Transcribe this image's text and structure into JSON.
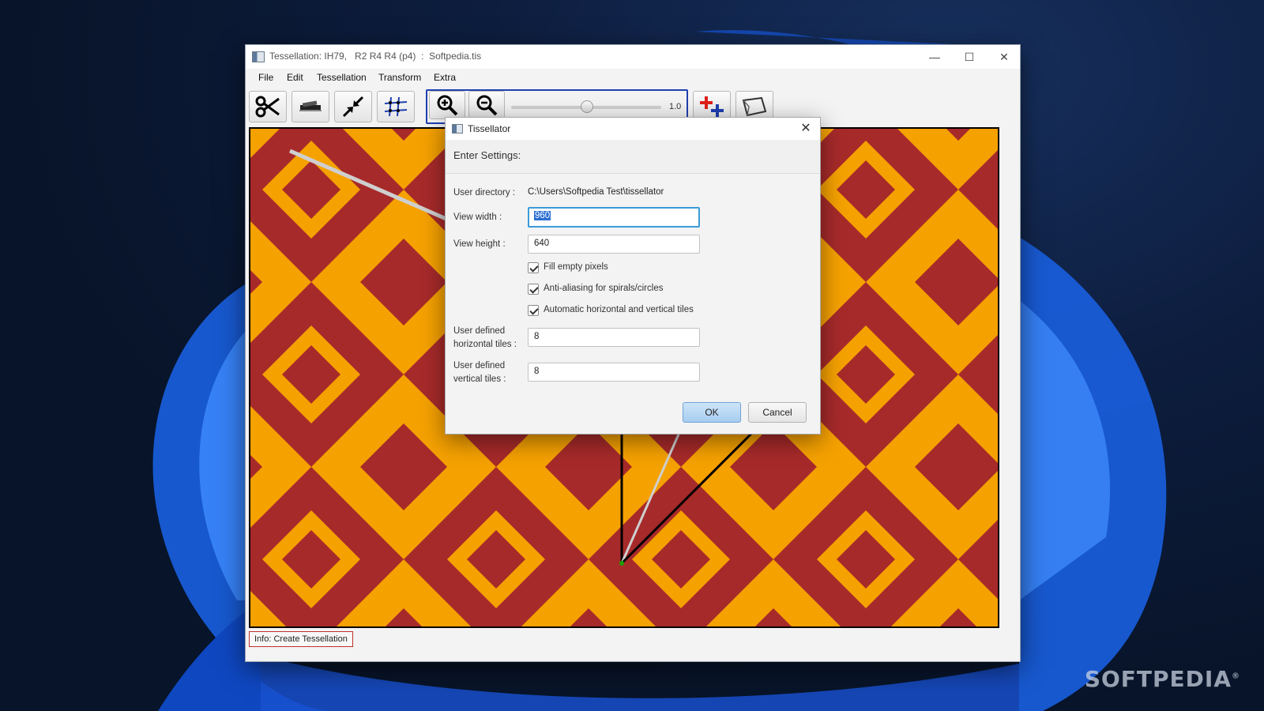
{
  "window": {
    "title": "Tessellation: IH79,   R2 R4 R4 (p4)  :  Softpedia.tis",
    "minimize": "—",
    "maximize": "☐",
    "close": "✕"
  },
  "menu": [
    "File",
    "Edit",
    "Tessellation",
    "Transform",
    "Extra"
  ],
  "toolbar": {
    "zoom_value": "1.0",
    "zoom_fraction": 0.5
  },
  "status": {
    "text": "Info: Create Tessellation"
  },
  "colors": {
    "tile_primary": "#f5a100",
    "tile_secondary": "#a72a2a",
    "accent": "#1f3fb0"
  },
  "dialog": {
    "title": "Tissellator",
    "header": "Enter Settings:",
    "user_directory_label": "User directory :",
    "user_directory_value": "C:\\Users\\Softpedia Test\\tissellator",
    "view_width_label": "View width :",
    "view_width_value": "960",
    "view_height_label": "View height :",
    "view_height_value": "640",
    "checkboxes": [
      {
        "label": "Fill empty pixels",
        "checked": true
      },
      {
        "label": "Anti-aliasing for spirals/circles",
        "checked": true
      },
      {
        "label": "Automatic horizontal and vertical tiles",
        "checked": true
      }
    ],
    "htiles_label_line1": "User defined",
    "htiles_label_line2": "horizontal tiles :",
    "htiles_value": "8",
    "vtiles_label_line1": "User defined",
    "vtiles_label_line2": "vertical tiles :",
    "vtiles_value": "8",
    "ok_label": "OK",
    "cancel_label": "Cancel"
  },
  "watermark": {
    "text": "SOFTPEDIA",
    "mark": "®"
  }
}
